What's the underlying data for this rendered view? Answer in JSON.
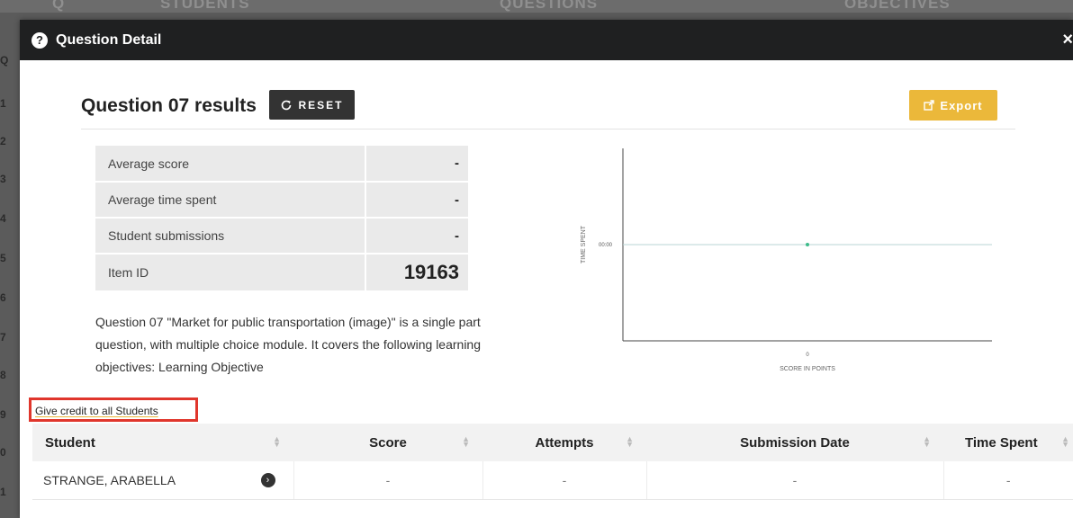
{
  "background": {
    "tabs": [
      "Q",
      "STUDENTS",
      "QUESTIONS",
      "OBJECTIVES"
    ],
    "row_numbers": [
      "Q",
      "1",
      "2",
      "3",
      "4",
      "5",
      "6",
      "7",
      "8",
      "9",
      "0",
      "1"
    ]
  },
  "modal": {
    "title": "Question Detail",
    "help_icon": "?",
    "close_icon": "×"
  },
  "results": {
    "title": "Question 07 results",
    "reset_label": "RESET",
    "export_label": "Export"
  },
  "stats": [
    {
      "label": "Average score",
      "value": "-"
    },
    {
      "label": "Average time spent",
      "value": "-"
    },
    {
      "label": "Student submissions",
      "value": "-"
    },
    {
      "label": "Item ID",
      "value": "19163"
    }
  ],
  "description": "Question 07 \"Market for public transportation (image)\" is a single part question, with multiple choice module. It covers the following learning objectives: Learning Objective",
  "chart_data": {
    "type": "scatter",
    "xlabel": "SCORE IN POINTS",
    "ylabel": "TIME SPENT",
    "x_ticks": [
      "0"
    ],
    "y_ticks": [
      "00:00"
    ],
    "points": [
      {
        "x": 0,
        "y": "00:00"
      }
    ],
    "point_color": "#3dbb8a",
    "grid": false
  },
  "credit_link": "Give credit to all Students",
  "table": {
    "columns": [
      "Student",
      "Score",
      "Attempts",
      "Submission Date",
      "Time Spent"
    ],
    "rows": [
      {
        "student": "STRANGE, ARABELLA",
        "score": "-",
        "attempts": "-",
        "submission_date": "-",
        "time_spent": "-"
      }
    ]
  }
}
